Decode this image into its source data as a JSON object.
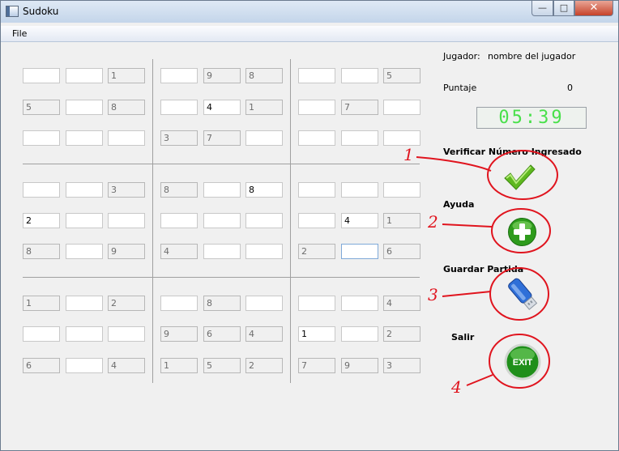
{
  "window": {
    "title": "Sudoku"
  },
  "menu": {
    "file": "File"
  },
  "titlebar_buttons": {
    "minimize": "—",
    "maximize": "□",
    "close": "✕"
  },
  "grid": [
    [
      {
        "v": "",
        "f": false
      },
      {
        "v": "",
        "f": false
      },
      {
        "v": "1",
        "f": true
      },
      {
        "v": "",
        "f": false
      },
      {
        "v": "9",
        "f": true
      },
      {
        "v": "8",
        "f": true
      },
      {
        "v": "",
        "f": false
      },
      {
        "v": "",
        "f": false
      },
      {
        "v": "5",
        "f": true
      }
    ],
    [
      {
        "v": "5",
        "f": true
      },
      {
        "v": "",
        "f": false
      },
      {
        "v": "8",
        "f": true
      },
      {
        "v": "",
        "f": false
      },
      {
        "v": "4",
        "f": false
      },
      {
        "v": "1",
        "f": true
      },
      {
        "v": "",
        "f": false
      },
      {
        "v": "7",
        "f": true
      },
      {
        "v": "",
        "f": false
      }
    ],
    [
      {
        "v": "",
        "f": false
      },
      {
        "v": "",
        "f": false
      },
      {
        "v": "",
        "f": false
      },
      {
        "v": "3",
        "f": true
      },
      {
        "v": "7",
        "f": true
      },
      {
        "v": "",
        "f": false
      },
      {
        "v": "",
        "f": false
      },
      {
        "v": "",
        "f": false
      },
      {
        "v": "",
        "f": false
      }
    ],
    [
      {
        "v": "",
        "f": false
      },
      {
        "v": "",
        "f": false
      },
      {
        "v": "3",
        "f": true
      },
      {
        "v": "8",
        "f": true
      },
      {
        "v": "",
        "f": false
      },
      {
        "v": "8",
        "f": false
      },
      {
        "v": "",
        "f": false
      },
      {
        "v": "",
        "f": false
      },
      {
        "v": "",
        "f": false
      }
    ],
    [
      {
        "v": "2",
        "f": false
      },
      {
        "v": "",
        "f": false
      },
      {
        "v": "",
        "f": false
      },
      {
        "v": "",
        "f": false
      },
      {
        "v": "",
        "f": false
      },
      {
        "v": "",
        "f": false
      },
      {
        "v": "",
        "f": false
      },
      {
        "v": "4",
        "f": false
      },
      {
        "v": "1",
        "f": true
      }
    ],
    [
      {
        "v": "8",
        "f": true
      },
      {
        "v": "",
        "f": false
      },
      {
        "v": "9",
        "f": true
      },
      {
        "v": "4",
        "f": true
      },
      {
        "v": "",
        "f": false
      },
      {
        "v": "",
        "f": false
      },
      {
        "v": "2",
        "f": true
      },
      {
        "v": "",
        "f": false,
        "focus": true
      },
      {
        "v": "6",
        "f": true
      }
    ],
    [
      {
        "v": "1",
        "f": true
      },
      {
        "v": "",
        "f": false
      },
      {
        "v": "2",
        "f": true
      },
      {
        "v": "",
        "f": false
      },
      {
        "v": "8",
        "f": true
      },
      {
        "v": "",
        "f": false
      },
      {
        "v": "",
        "f": false
      },
      {
        "v": "",
        "f": false
      },
      {
        "v": "4",
        "f": true
      }
    ],
    [
      {
        "v": "",
        "f": false
      },
      {
        "v": "",
        "f": false
      },
      {
        "v": "",
        "f": false
      },
      {
        "v": "9",
        "f": true
      },
      {
        "v": "6",
        "f": true
      },
      {
        "v": "4",
        "f": true
      },
      {
        "v": "1",
        "f": false
      },
      {
        "v": "",
        "f": false
      },
      {
        "v": "2",
        "f": true
      }
    ],
    [
      {
        "v": "6",
        "f": true
      },
      {
        "v": "",
        "f": false
      },
      {
        "v": "4",
        "f": true
      },
      {
        "v": "1",
        "f": true
      },
      {
        "v": "5",
        "f": true
      },
      {
        "v": "2",
        "f": true
      },
      {
        "v": "7",
        "f": true
      },
      {
        "v": "9",
        "f": true
      },
      {
        "v": "3",
        "f": true
      }
    ]
  ],
  "side": {
    "player_label": "Jugador:",
    "player_name": "nombre del jugador",
    "score_label": "Puntaje",
    "score_value": "0",
    "timer": "05:39",
    "verify_label": "Verificar Número Ingresado",
    "help_label": "Ayuda",
    "save_label": "Guardar Partida",
    "exit_label": "Salir",
    "exit_button_text": "EXIT"
  },
  "annotations": [
    "1",
    "2",
    "3",
    "4"
  ],
  "colors": {
    "timer_digits": "#49e04b",
    "annotation_red": "#e0141e",
    "check_green": "#5fb81f",
    "help_green": "#2e9b1c",
    "save_blue": "#2f6fd8",
    "exit_green": "#1f8f1a"
  },
  "icons": {
    "verify": "check-icon",
    "help": "plus-icon",
    "save": "usb-drive-icon",
    "exit": "exit-icon"
  }
}
